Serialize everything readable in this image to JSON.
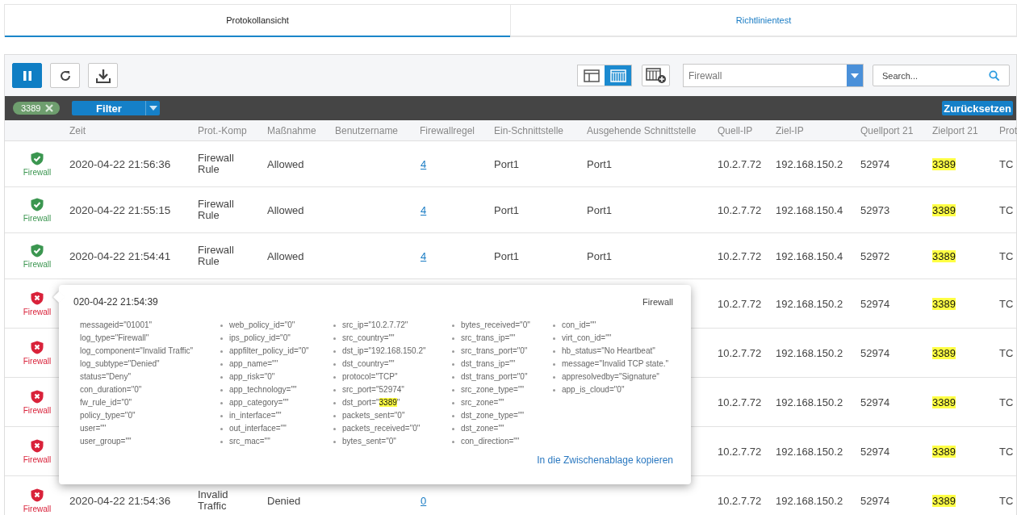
{
  "tabs": [
    {
      "label": "Protokollansicht",
      "selected": true
    },
    {
      "label": "Richtlinientest",
      "selected": false
    }
  ],
  "toolbar": {
    "pause": {
      "selected": true
    },
    "views": [
      {
        "kind": "split",
        "selected": false
      },
      {
        "kind": "columns",
        "selected": true
      }
    ],
    "log_type": {
      "value": "Firewall"
    },
    "search": {
      "placeholder": "Search..."
    }
  },
  "filter_bar": {
    "chips": [
      {
        "label": "3389"
      }
    ],
    "filter_button": "Filter",
    "reset_button": "Zurücksetzen"
  },
  "table": {
    "columns": [
      "Zeit",
      "Prot.-Komp",
      "Maßnahme",
      "Benutzername",
      "Firewallregel",
      "Ein-Schnittstelle",
      "Ausgehende Schnittstelle",
      "Quell-IP",
      "Ziel-IP",
      "Quellport 21",
      "Zielport 21",
      "Prot"
    ],
    "rows": [
      {
        "kind": "allowed",
        "source": "Firewall",
        "time": "2020-04-22 21:56:36",
        "component": "Firewall Rule",
        "action": "Allowed",
        "rule": "4",
        "in_if": "Port1",
        "out_if": "Port1",
        "src_ip": "10.2.7.72",
        "dst_ip": "192.168.150.2",
        "src_port": "52974",
        "dst_port": "3389",
        "dst_port_match": true,
        "proto": "TC"
      },
      {
        "kind": "allowed",
        "source": "Firewall",
        "time": "2020-04-22 21:55:15",
        "component": "Firewall Rule",
        "action": "Allowed",
        "rule": "4",
        "in_if": "Port1",
        "out_if": "Port1",
        "src_ip": "10.2.7.72",
        "dst_ip": "192.168.150.4",
        "src_port": "52973",
        "dst_port": "3389",
        "dst_port_match": true,
        "proto": "TC"
      },
      {
        "kind": "allowed",
        "source": "Firewall",
        "time": "2020-04-22 21:54:41",
        "component": "Firewall Rule",
        "action": "Allowed",
        "rule": "4",
        "in_if": "Port1",
        "out_if": "Port1",
        "src_ip": "10.2.7.72",
        "dst_ip": "192.168.150.4",
        "src_port": "52972",
        "dst_port": "3389",
        "dst_port_match": true,
        "proto": "TC"
      },
      {
        "kind": "denied",
        "source": "Firewall",
        "src_ip": "10.2.7.72",
        "dst_ip": "192.168.150.2",
        "src_port": "52974",
        "dst_port": "3389",
        "dst_port_match": true,
        "proto": "TC"
      },
      {
        "kind": "denied",
        "source": "Firewall",
        "src_ip": "10.2.7.72",
        "dst_ip": "192.168.150.2",
        "src_port": "52974",
        "dst_port": "3389",
        "dst_port_match": true,
        "proto": "TC"
      },
      {
        "kind": "denied",
        "source": "Firewall",
        "src_ip": "10.2.7.72",
        "dst_ip": "192.168.150.2",
        "src_port": "52974",
        "dst_port": "3389",
        "dst_port_match": true,
        "proto": "TC"
      },
      {
        "kind": "denied",
        "source": "Firewall",
        "src_ip": "10.2.7.72",
        "dst_ip": "192.168.150.2",
        "src_port": "52974",
        "dst_port": "3389",
        "dst_port_match": true,
        "proto": "TC"
      },
      {
        "kind": "denied",
        "source": "Firewall",
        "time": "2020-04-22 21:54:36",
        "component": "Invalid Traffic",
        "action": "Denied",
        "rule": "0",
        "src_ip": "10.2.7.72",
        "dst_ip": "192.168.150.2",
        "src_port": "52974",
        "dst_port": "3389",
        "dst_port_match": true,
        "proto": "TC"
      }
    ]
  },
  "detail_popup": {
    "time": "020-04-22 21:54:39",
    "log_type": "Firewall",
    "columns": [
      {
        "bulleted": false,
        "items": [
          "messageid=\"01001\"",
          "log_type=\"Firewall\"",
          "log_component=\"Invalid Traffic\"",
          "log_subtype=\"Denied\"",
          "status=\"Deny\"",
          "con_duration=\"0\"",
          "fw_rule_id=\"0\"",
          "policy_type=\"0\"",
          "user=\"\"",
          "user_group=\"\""
        ]
      },
      {
        "bulleted": true,
        "items": [
          "web_policy_id=\"0\"",
          "ips_policy_id=\"0\"",
          "appfilter_policy_id=\"0\"",
          "app_name=\"\"",
          "app_risk=\"0\"",
          "app_technology=\"\"",
          "app_category=\"\"",
          "in_interface=\"\"",
          "out_interface=\"\"",
          "src_mac=\"\""
        ]
      },
      {
        "bulleted": true,
        "items": [
          "src_ip=\"10.2.7.72\"",
          "src_country=\"\"",
          "dst_ip=\"192.168.150.2\"",
          "dst_country=\"\"",
          "protocol=\"TCP\"",
          "src_port=\"52974\"",
          {
            "text": "dst_port=\"",
            "highlight": "3389",
            "rest": "\""
          },
          "packets_sent=\"0\"",
          "packets_received=\"0\"",
          "bytes_sent=\"0\""
        ]
      },
      {
        "bulleted": true,
        "items": [
          "bytes_received=\"0\"",
          "src_trans_ip=\"\"",
          "src_trans_port=\"0\"",
          "dst_trans_ip=\"\"",
          "dst_trans_port=\"0\"",
          "src_zone_type=\"\"",
          "src_zone=\"\"",
          "dst_zone_type=\"\"",
          "dst_zone=\"\"",
          "con_direction=\"\""
        ]
      },
      {
        "bulleted": true,
        "items": [
          "con_id=\"\"",
          "virt_con_id=\"\"",
          "hb_status=\"No Heartbeat\"",
          "message=\"Invalid TCP state.\"",
          "appresolvedby=\"Signature\"",
          "app_is_cloud=\"0\""
        ]
      }
    ],
    "copy_link": "In die Zwischenablage kopieren"
  }
}
